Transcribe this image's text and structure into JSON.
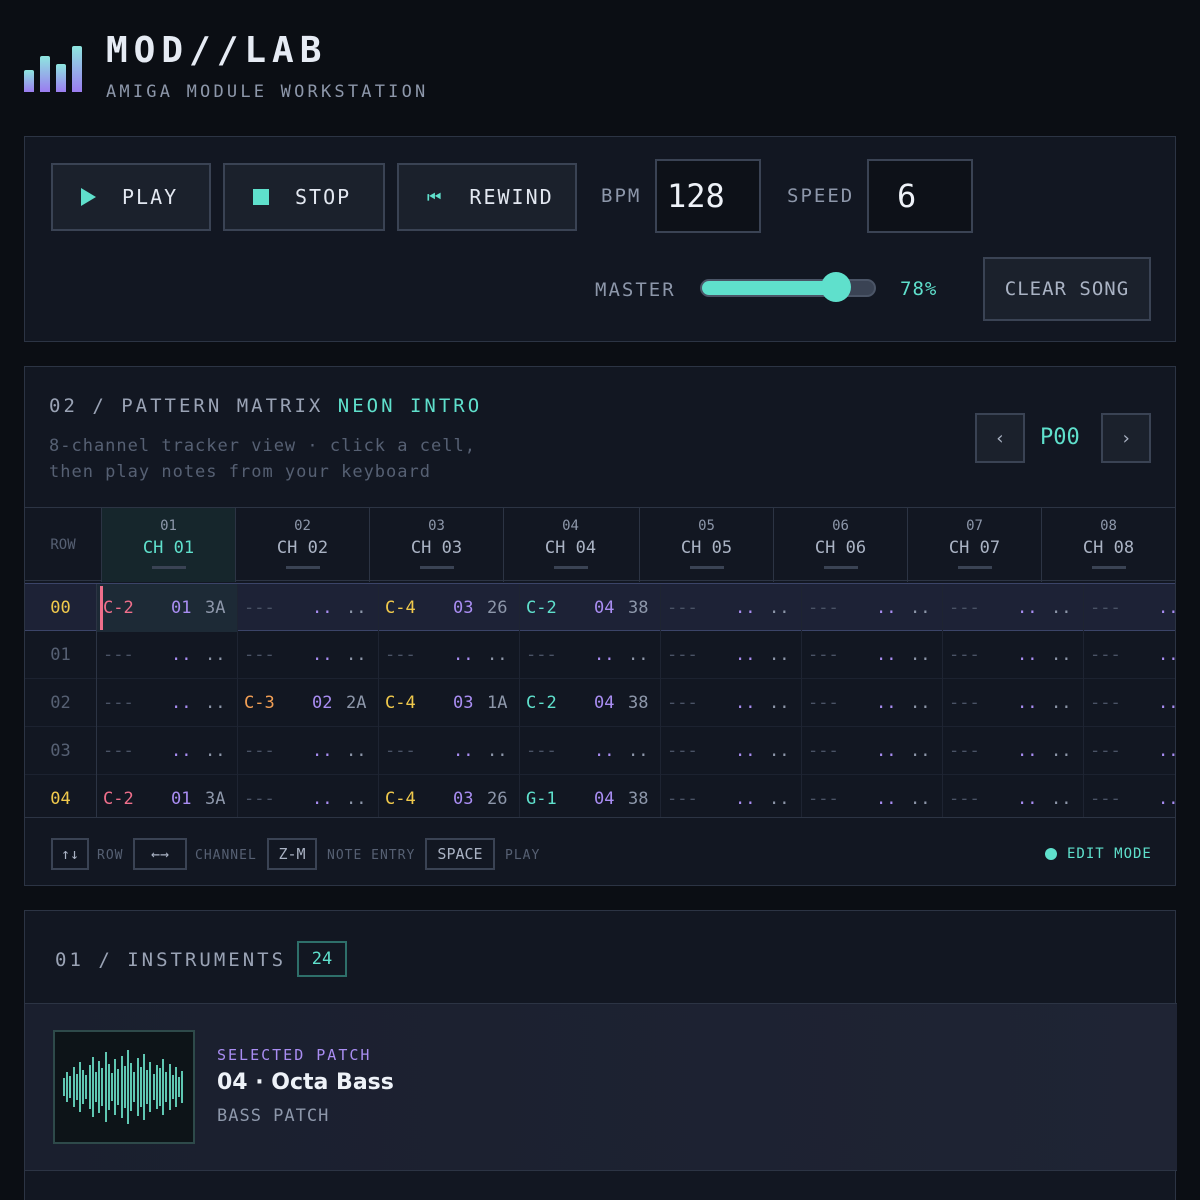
{
  "header": {
    "title": "MOD//LAB",
    "subtitle": "AMIGA MODULE WORKSTATION"
  },
  "transport": {
    "play_label": "PLAY",
    "stop_label": "STOP",
    "rewind_label": "REWIND",
    "bpm_label": "BPM",
    "bpm_value": "128",
    "speed_label": "SPEED",
    "speed_value": "6",
    "master_label": "MASTER",
    "master_value": "78%",
    "master_level": 0.78,
    "clear_label": "CLEAR SONG"
  },
  "pattern": {
    "section": "02 / PATTERN MATRIX",
    "name": "NEON INTRO",
    "desc_1": "8-channel tracker view · click a cell,",
    "desc_2": "then play notes from your keyboard",
    "prev": "‹",
    "next": "›",
    "pattern_id": "P00",
    "row_header": "ROW",
    "channels": [
      {
        "num": "01",
        "name": "CH 01"
      },
      {
        "num": "02",
        "name": "CH 02"
      },
      {
        "num": "03",
        "name": "CH 03"
      },
      {
        "num": "04",
        "name": "CH 04"
      },
      {
        "num": "05",
        "name": "CH 05"
      },
      {
        "num": "06",
        "name": "CH 06"
      },
      {
        "num": "07",
        "name": "CH 07"
      },
      {
        "num": "08",
        "name": "CH 08"
      }
    ],
    "rows": [
      {
        "id": "00",
        "cells": [
          [
            "C-2",
            "01",
            "3A"
          ],
          [
            "---",
            "..",
            ".."
          ],
          [
            "C-4",
            "03",
            "26"
          ],
          [
            "C-2",
            "04",
            "38"
          ],
          [
            "---",
            "..",
            ".."
          ],
          [
            "---",
            "..",
            ".."
          ],
          [
            "---",
            "..",
            ".."
          ],
          [
            "---",
            "..",
            ".."
          ]
        ]
      },
      {
        "id": "01",
        "cells": [
          [
            "---",
            "..",
            ".."
          ],
          [
            "---",
            "..",
            ".."
          ],
          [
            "---",
            "..",
            ".."
          ],
          [
            "---",
            "..",
            ".."
          ],
          [
            "---",
            "..",
            ".."
          ],
          [
            "---",
            "..",
            ".."
          ],
          [
            "---",
            "..",
            ".."
          ],
          [
            "---",
            "..",
            ".."
          ]
        ]
      },
      {
        "id": "02",
        "cells": [
          [
            "---",
            "..",
            ".."
          ],
          [
            "C-3",
            "02",
            "2A"
          ],
          [
            "C-4",
            "03",
            "1A"
          ],
          [
            "C-2",
            "04",
            "38"
          ],
          [
            "---",
            "..",
            ".."
          ],
          [
            "---",
            "..",
            ".."
          ],
          [
            "---",
            "..",
            ".."
          ],
          [
            "---",
            "..",
            ".."
          ]
        ]
      },
      {
        "id": "03",
        "cells": [
          [
            "---",
            "..",
            ".."
          ],
          [
            "---",
            "..",
            ".."
          ],
          [
            "---",
            "..",
            ".."
          ],
          [
            "---",
            "..",
            ".."
          ],
          [
            "---",
            "..",
            ".."
          ],
          [
            "---",
            "..",
            ".."
          ],
          [
            "---",
            "..",
            ".."
          ],
          [
            "---",
            "..",
            ".."
          ]
        ]
      },
      {
        "id": "04",
        "cells": [
          [
            "C-2",
            "01",
            "3A"
          ],
          [
            "---",
            "..",
            ".."
          ],
          [
            "C-4",
            "03",
            "26"
          ],
          [
            "G-1",
            "04",
            "38"
          ],
          [
            "---",
            "..",
            ".."
          ],
          [
            "---",
            "..",
            ".."
          ],
          [
            "---",
            "..",
            ".."
          ],
          [
            "---",
            "..",
            ".."
          ]
        ]
      }
    ],
    "keys": [
      {
        "key": "↑↓",
        "label": "ROW"
      },
      {
        "key": "←→",
        "label": "CHANNEL"
      },
      {
        "key": "Z-M",
        "label": "NOTE ENTRY"
      },
      {
        "key": "SPACE",
        "label": "PLAY"
      }
    ],
    "edit_mode": "EDIT MODE"
  },
  "instruments": {
    "section": "01 / INSTRUMENTS",
    "count": "24",
    "selected_label": "SELECTED PATCH",
    "patch_name": "04 · Octa Bass",
    "patch_type": "BASS PATCH"
  },
  "colors": {
    "accent": "#5fe0cc",
    "instrument": "#a98df2",
    "row_highlight": "#f0c94c",
    "cursor": "#ef6f8b"
  }
}
